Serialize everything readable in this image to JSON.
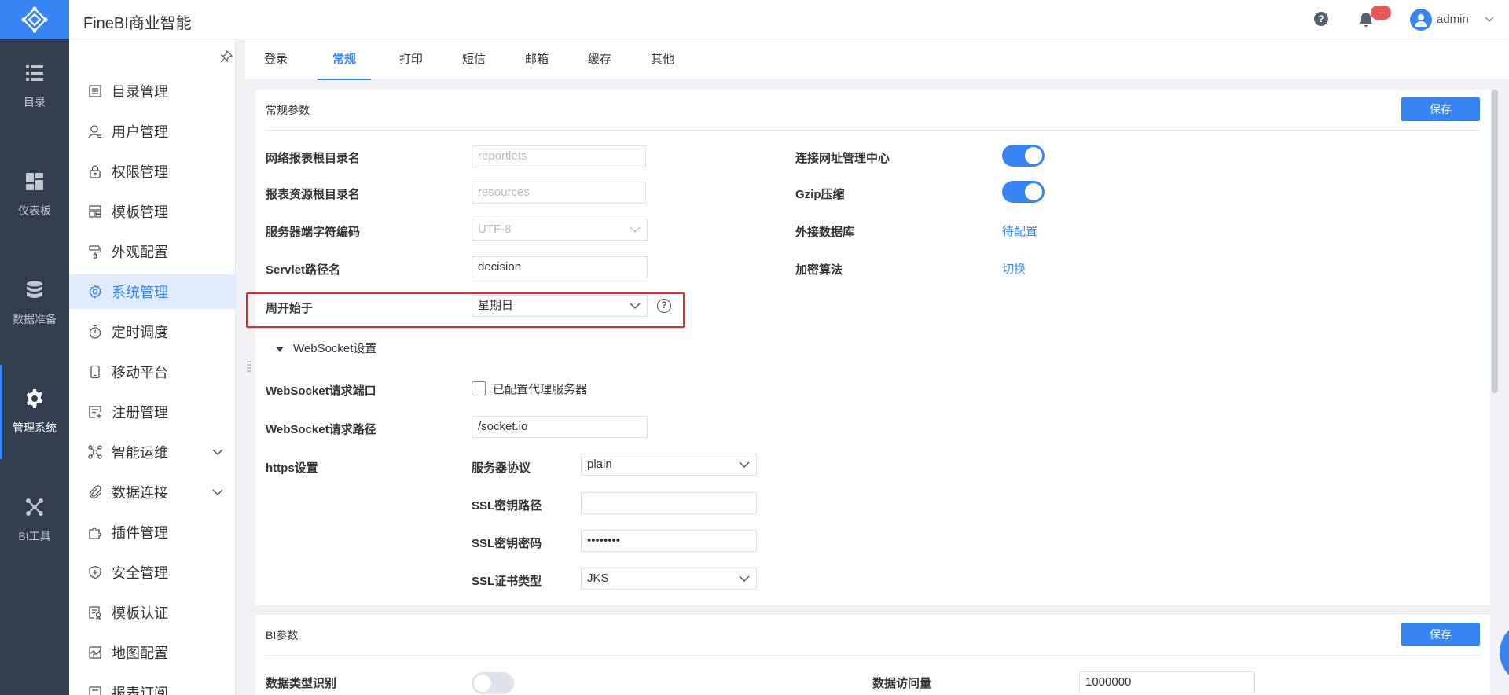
{
  "app": {
    "title": "FineBI商业智能"
  },
  "header": {
    "badge": "...",
    "user": "admin"
  },
  "rail": {
    "items": [
      {
        "label": "目录",
        "icon": "list-icon"
      },
      {
        "label": "仪表板",
        "icon": "dashboard-icon"
      },
      {
        "label": "数据准备",
        "icon": "database-icon"
      },
      {
        "label": "管理系统",
        "icon": "gear-icon",
        "active": true
      },
      {
        "label": "BI工具",
        "icon": "network-icon"
      }
    ]
  },
  "menu": {
    "items": [
      {
        "label": "目录管理",
        "icon": "catalog-icon"
      },
      {
        "label": "用户管理",
        "icon": "user-icon"
      },
      {
        "label": "权限管理",
        "icon": "lock-icon"
      },
      {
        "label": "模板管理",
        "icon": "template-icon"
      },
      {
        "label": "外观配置",
        "icon": "paint-roller-icon"
      },
      {
        "label": "系统管理",
        "icon": "gear-icon",
        "active": true
      },
      {
        "label": "定时调度",
        "icon": "stopwatch-icon"
      },
      {
        "label": "移动平台",
        "icon": "mobile-icon"
      },
      {
        "label": "注册管理",
        "icon": "register-icon"
      },
      {
        "label": "智能运维",
        "icon": "ops-icon",
        "expandable": true
      },
      {
        "label": "数据连接",
        "icon": "paperclip-icon",
        "expandable": true
      },
      {
        "label": "插件管理",
        "icon": "puzzle-icon"
      },
      {
        "label": "安全管理",
        "icon": "shield-icon"
      },
      {
        "label": "模板认证",
        "icon": "certificate-icon"
      },
      {
        "label": "地图配置",
        "icon": "map-icon"
      },
      {
        "label": "报表订阅",
        "icon": "subscribe-icon"
      }
    ]
  },
  "tabs": [
    {
      "label": "登录"
    },
    {
      "label": "常规",
      "active": true
    },
    {
      "label": "打印"
    },
    {
      "label": "短信"
    },
    {
      "label": "邮箱"
    },
    {
      "label": "缓存"
    },
    {
      "label": "其他"
    }
  ],
  "general": {
    "title": "常规参数",
    "save": "保存",
    "report_root": {
      "label": "网络报表根目录名",
      "placeholder": "reportlets"
    },
    "resource_root": {
      "label": "报表资源根目录名",
      "placeholder": "resources"
    },
    "charset": {
      "label": "服务器端字符编码",
      "value": "UTF-8"
    },
    "servlet": {
      "label": "Servlet路径名",
      "value": "decision"
    },
    "week_start": {
      "label": "周开始于",
      "value": "星期日",
      "help": "?"
    },
    "url_center": {
      "label": "连接网址管理中心",
      "on": true
    },
    "gzip": {
      "label": "Gzip压缩",
      "on": true
    },
    "ext_db": {
      "label": "外接数据库",
      "link": "待配置"
    },
    "encrypt": {
      "label": "加密算法",
      "link": "切换"
    },
    "websocket": {
      "section": "WebSocket设置",
      "port_label": "WebSocket请求端口",
      "proxy_label": "已配置代理服务器",
      "proxy_checked": false,
      "path_label": "WebSocket请求路径",
      "path_value": "/socket.io"
    },
    "https": {
      "label": "https设置",
      "protocol_label": "服务器协议",
      "protocol_value": "plain",
      "ssl_path_label": "SSL密钥路径",
      "ssl_path_value": "",
      "ssl_pwd_label": "SSL密钥密码",
      "ssl_pwd_value": "••••••••",
      "ssl_type_label": "SSL证书类型",
      "ssl_type_value": "JKS"
    }
  },
  "bi": {
    "title": "BI参数",
    "save": "保存",
    "type_detect_label": "数据类型识别",
    "type_detect_on": false,
    "access_label": "数据访问量",
    "access_value": "1000000"
  }
}
